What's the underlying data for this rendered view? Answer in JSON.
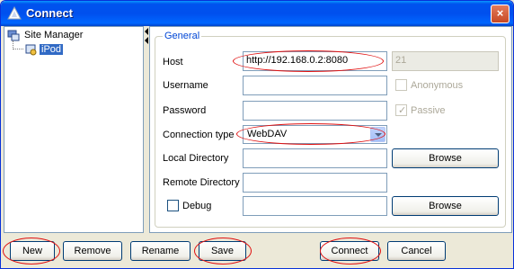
{
  "window": {
    "title": "Connect",
    "close_label": "×"
  },
  "tree": {
    "root": {
      "label": "Site Manager",
      "icon": "site-manager-icon"
    },
    "selected": {
      "label": "iPod",
      "icon": "site-icon"
    }
  },
  "group": {
    "legend": "General"
  },
  "form": {
    "host": {
      "label": "Host",
      "value": "http://192.168.0.2:8080",
      "port": "21"
    },
    "username": {
      "label": "Username",
      "value": ""
    },
    "anonymous": {
      "label": "Anonymous",
      "checked": false
    },
    "password": {
      "label": "Password",
      "value": ""
    },
    "passive": {
      "label": "Passive",
      "checked": true
    },
    "connection_type": {
      "label": "Connection type",
      "value": "WebDAV"
    },
    "local_directory": {
      "label": "Local Directory",
      "value": ""
    },
    "remote_directory": {
      "label": "Remote Directory",
      "value": ""
    },
    "debug": {
      "label": "Debug",
      "checked": false
    },
    "browse_label": "Browse"
  },
  "buttons": {
    "new": "New",
    "remove": "Remove",
    "rename": "Rename",
    "save": "Save",
    "connect": "Connect",
    "cancel": "Cancel"
  },
  "colors": {
    "titlebar": "#0053ee",
    "highlight": "#e01010",
    "selection": "#316ac5"
  }
}
